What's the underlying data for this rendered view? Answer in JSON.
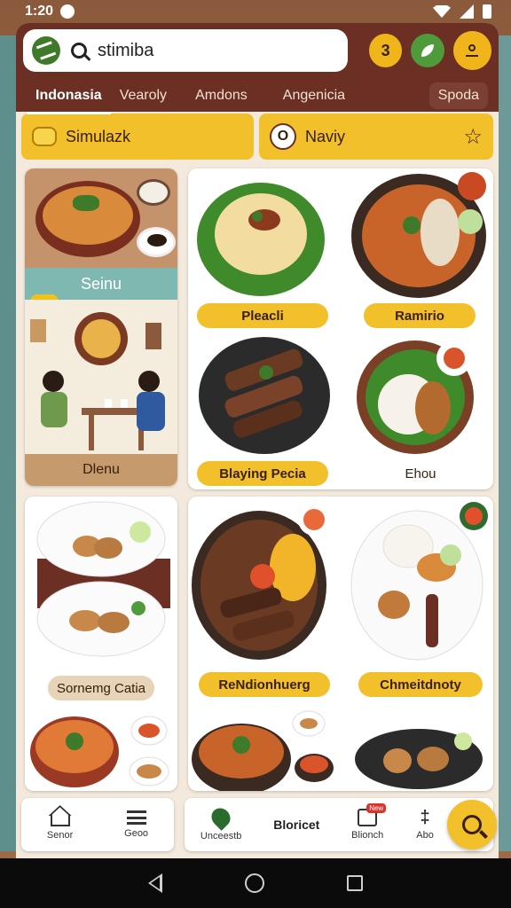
{
  "status_bar": {
    "time": "1:20"
  },
  "search": {
    "query": "stimiba"
  },
  "header_buttons": {
    "a": "3",
    "b": "",
    "c": ""
  },
  "tabs": [
    "Indonasia",
    "Vearoly",
    "Amdons",
    "Angenicia",
    "Spoda"
  ],
  "banners": {
    "left": "Simulazk",
    "right": "Naviy"
  },
  "promo": {
    "title": "Seinu",
    "footer": "Dlenu"
  },
  "dishes": [
    {
      "label": "Pleacli"
    },
    {
      "label": "Ramirio"
    },
    {
      "label": "Blaying Pecia"
    },
    {
      "label": "Ehou"
    },
    {
      "label": "Sornemg Catia"
    },
    {
      "label": "ReNdionhuerg"
    },
    {
      "label": "Chmeitdnoty"
    }
  ],
  "bottom_nav": {
    "left": [
      {
        "label": "Senor",
        "icon": "home-icon"
      },
      {
        "label": "Geoo",
        "icon": "menu-icon"
      }
    ],
    "right": [
      {
        "label": "Unceestb",
        "icon": "pin-icon"
      },
      {
        "label": "Bloricet",
        "icon": ""
      },
      {
        "label": "Blionch",
        "icon": "doc-icon",
        "badge": "New"
      },
      {
        "label": "Abo",
        "icon": "share-icon"
      }
    ]
  },
  "colors": {
    "header": "#6b2f24",
    "accent": "#f2c02a",
    "green": "#4f9a3a"
  }
}
